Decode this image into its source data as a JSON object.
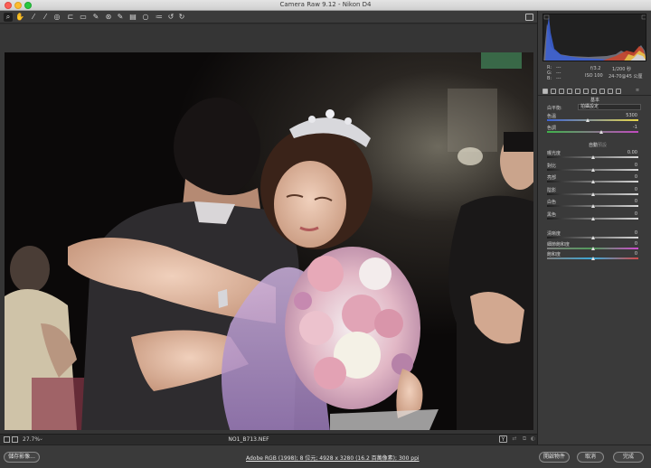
{
  "window": {
    "title": "Camera Raw 9.12 - Nikon D4"
  },
  "toolbar": {
    "tools": [
      {
        "name": "zoom-tool",
        "glyph": "⌕"
      },
      {
        "name": "hand-tool",
        "glyph": "✋"
      },
      {
        "name": "white-balance-tool",
        "glyph": "⁄"
      },
      {
        "name": "color-sampler-tool",
        "glyph": "⁄"
      },
      {
        "name": "targeted-adjustment-tool",
        "glyph": "◎"
      },
      {
        "name": "crop-tool",
        "glyph": "⊏"
      },
      {
        "name": "straighten-tool",
        "glyph": "▭"
      },
      {
        "name": "spot-removal-tool",
        "glyph": "✎"
      },
      {
        "name": "red-eye-tool",
        "glyph": "⊛"
      },
      {
        "name": "adjustment-brush-tool",
        "glyph": "✎"
      },
      {
        "name": "graduated-filter-tool",
        "glyph": "▤"
      },
      {
        "name": "radial-filter-tool",
        "glyph": "○"
      },
      {
        "name": "preferences-tool",
        "glyph": "≔"
      },
      {
        "name": "rotate-left-tool",
        "glyph": "↺"
      },
      {
        "name": "rotate-right-tool",
        "glyph": "↻"
      }
    ]
  },
  "preview_footer": {
    "zoom": "27.7%",
    "filename": "NO1_B713.NEF",
    "y_button": "Y"
  },
  "readout": {
    "r_label": "R:",
    "r_value": "---",
    "g_label": "G:",
    "g_value": "---",
    "b_label": "B:",
    "b_value": "---",
    "aperture": "f/3.2",
    "shutter": "1/200 秒",
    "iso": "ISO 100",
    "lens": "24-70@45 公厘"
  },
  "panel": {
    "section_title": "基本",
    "wb_label": "白平衡:",
    "wb_value": "拍攝設定",
    "temp": {
      "label": "色溫",
      "value": "5300",
      "level": 0.45
    },
    "tint": {
      "label": "色調",
      "value": "-1",
      "level": 0.59
    },
    "auto_label": "自動",
    "default_label": "預設",
    "tone": [
      {
        "label": "曝光度",
        "value": "0.00",
        "level": 0.5
      },
      {
        "label": "對比",
        "value": "0",
        "level": 0.5
      },
      {
        "label": "亮部",
        "value": "0",
        "level": 0.5
      },
      {
        "label": "陰影",
        "value": "0",
        "level": 0.5
      },
      {
        "label": "白色",
        "value": "0",
        "level": 0.5
      },
      {
        "label": "黑色",
        "value": "0",
        "level": 0.5
      }
    ],
    "presence": [
      {
        "label": "清晰度",
        "value": "0",
        "level": 0.5
      },
      {
        "label": "細節飽和度",
        "value": "0",
        "level": 0.5
      },
      {
        "label": "飽和度",
        "value": "0",
        "level": 0.5
      }
    ]
  },
  "bottombar": {
    "save_label": "儲存影像...",
    "workflow_text": "Adobe RGB (1998); 8 位元; 4928 x 3280 (16.2 百萬像素); 300 ppi",
    "open_label": "開啟物件",
    "cancel_label": "取消",
    "done_label": "完成"
  },
  "colors": {
    "temp_track": [
      "#3b62d6",
      "#e8d84a"
    ],
    "tint_track": [
      "#3fb24a",
      "#c24ac0"
    ],
    "saturation_track": [
      "#888888",
      "#ff4040"
    ]
  }
}
